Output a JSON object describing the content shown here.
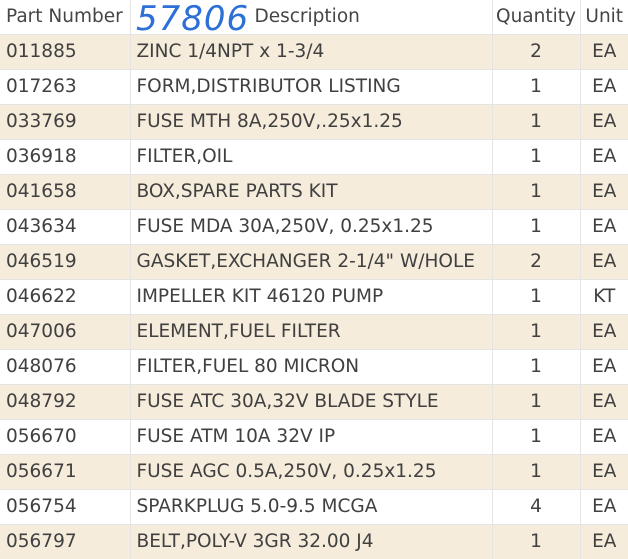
{
  "header": {
    "part_number": "Part Number",
    "description": "Description",
    "quantity": "Quantity",
    "unit": "Unit",
    "handwritten_note": "57806"
  },
  "rows": [
    {
      "part": "011885",
      "desc": "ZINC 1/4NPT x 1-3/4",
      "qty": "2",
      "unit": "EA"
    },
    {
      "part": "017263",
      "desc": "FORM,DISTRIBUTOR LISTING",
      "qty": "1",
      "unit": "EA"
    },
    {
      "part": "033769",
      "desc": "FUSE MTH 8A,250V,.25x1.25",
      "qty": "1",
      "unit": "EA"
    },
    {
      "part": "036918",
      "desc": "FILTER,OIL",
      "qty": "1",
      "unit": "EA"
    },
    {
      "part": "041658",
      "desc": "BOX,SPARE PARTS KIT",
      "qty": "1",
      "unit": "EA"
    },
    {
      "part": "043634",
      "desc": "FUSE MDA 30A,250V, 0.25x1.25",
      "qty": "1",
      "unit": "EA"
    },
    {
      "part": "046519",
      "desc": "GASKET,EXCHANGER 2-1/4\" W/HOLE",
      "qty": "2",
      "unit": "EA"
    },
    {
      "part": "046622",
      "desc": "IMPELLER KIT 46120 PUMP",
      "qty": "1",
      "unit": "KT"
    },
    {
      "part": "047006",
      "desc": "ELEMENT,FUEL FILTER",
      "qty": "1",
      "unit": "EA"
    },
    {
      "part": "048076",
      "desc": "FILTER,FUEL 80 MICRON",
      "qty": "1",
      "unit": "EA"
    },
    {
      "part": "048792",
      "desc": "FUSE ATC 30A,32V BLADE STYLE",
      "qty": "1",
      "unit": "EA"
    },
    {
      "part": "056670",
      "desc": "FUSE ATM 10A 32V IP",
      "qty": "1",
      "unit": "EA"
    },
    {
      "part": "056671",
      "desc": "FUSE AGC 0.5A,250V, 0.25x1.25",
      "qty": "1",
      "unit": "EA"
    },
    {
      "part": "056754",
      "desc": "SPARKPLUG 5.0-9.5 MCGA",
      "qty": "4",
      "unit": "EA"
    },
    {
      "part": "056797",
      "desc": "BELT,POLY-V 3GR 32.00 J4",
      "qty": "1",
      "unit": "EA"
    }
  ]
}
